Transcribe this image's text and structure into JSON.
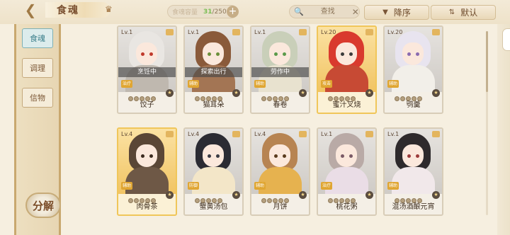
{
  "header": {
    "title": "食魂",
    "capacity_label": "食魂容量",
    "capacity_current": "31",
    "capacity_max": "/250",
    "search_placeholder": "查找",
    "sort_desc_label": "降序",
    "sort_default_label": "默认"
  },
  "sidebar": {
    "tabs": [
      {
        "label": "食魂",
        "active": true
      },
      {
        "label": "调理",
        "active": false
      },
      {
        "label": "信物",
        "active": false
      }
    ],
    "decompose_label": "分解"
  },
  "cards": [
    {
      "level": "Lv.1",
      "name": "饺子",
      "status": "烹饪中",
      "role": "治疗",
      "gold": false,
      "hair": "#e9e6e2",
      "eye": "#c0392b",
      "body": "#bfb8af",
      "stars": 5
    },
    {
      "level": "Lv.1",
      "name": "猫耳朵",
      "status": "探索出行",
      "role": "辅助",
      "gold": false,
      "hair": "#8a5a3a",
      "eye": "#6b8f3a",
      "body": "#a37554",
      "stars": 5
    },
    {
      "level": "Lv.1",
      "name": "春卷",
      "status": "劳作中",
      "role": "辅助",
      "gold": false,
      "hair": "#c9cfb9",
      "eye": "#5b9a4a",
      "body": "#e8e2cf",
      "stars": 5
    },
    {
      "level": "Lv.20",
      "name": "蜜汁叉烧",
      "status": "",
      "role": "攻击",
      "gold": true,
      "hair": "#d93a2e",
      "eye": "#3b3b3b",
      "body": "#c74a34",
      "stars": 5
    },
    {
      "level": "Lv.20",
      "name": "鸮羹",
      "status": "",
      "role": "辅助",
      "gold": false,
      "hair": "#e8e4ef",
      "eye": "#8a6bb0",
      "body": "#f2efe9",
      "stars": 5
    },
    {
      "level": "Lv.4",
      "name": "肉骨茶",
      "status": "",
      "role": "辅助",
      "gold": true,
      "hair": "#5a4636",
      "eye": "#3b2a1f",
      "body": "#6e5846",
      "stars": 5
    },
    {
      "level": "Lv.4",
      "name": "蟹黄汤包",
      "status": "",
      "role": "防御",
      "gold": false,
      "hair": "#2b2b33",
      "eye": "#3a3a44",
      "body": "#f3e6c8",
      "stars": 5
    },
    {
      "level": "Lv.4",
      "name": "月饼",
      "status": "",
      "role": "辅助",
      "gold": false,
      "hair": "#b78452",
      "eye": "#5a3b1e",
      "body": "#e6b24f",
      "stars": 5
    },
    {
      "level": "Lv.1",
      "name": "桃花粥",
      "status": "",
      "role": "治疗",
      "gold": false,
      "hair": "#b9aaa6",
      "eye": "#7a5a66",
      "body": "#eadde6",
      "stars": 5
    },
    {
      "level": "Lv.1",
      "name": "混汤酒酿元宵",
      "status": "",
      "role": "辅助",
      "gold": false,
      "hair": "#2e2a2c",
      "eye": "#9c3b3b",
      "body": "#f1e8ea",
      "stars": 5
    }
  ]
}
